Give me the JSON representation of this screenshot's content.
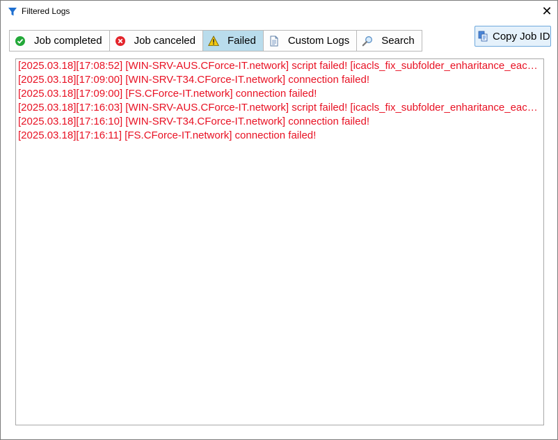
{
  "window": {
    "title": "Filtered Logs",
    "close_glyph": "✕"
  },
  "tabs": [
    {
      "label": "Job completed",
      "icon": "check-circle-icon",
      "color": "#22a838"
    },
    {
      "label": "Job canceled",
      "icon": "cancel-circle-icon",
      "color": "#e3242b"
    },
    {
      "label": "Failed",
      "icon": "warning-icon",
      "color": "#f2c811",
      "active": true
    },
    {
      "label": "Custom Logs",
      "icon": "document-icon",
      "color": "#5d7ea6"
    },
    {
      "label": "Search",
      "icon": "magnifier-icon",
      "color": "#5a8fc6"
    }
  ],
  "toolbar": {
    "copy_label": "Copy Job ID"
  },
  "logs": [
    "[2025.03.18][17:08:52] [WIN-SRV-AUS.CForce-IT.network] script failed! [icacls_fix_subfolder_enharitance_each_fil...",
    "[2025.03.18][17:09:00] [WIN-SRV-T34.CForce-IT.network] connection failed!",
    "[2025.03.18][17:09:00] [FS.CForce-IT.network] connection failed!",
    "[2025.03.18][17:16:03] [WIN-SRV-AUS.CForce-IT.network] script failed! [icacls_fix_subfolder_enharitance_each_fil...",
    "[2025.03.18][17:16:10] [WIN-SRV-T34.CForce-IT.network] connection failed!",
    "[2025.03.18][17:16:11] [FS.CForce-IT.network] connection failed!"
  ],
  "colors": {
    "error_text": "#e81123",
    "active_tab": "#b9dcec",
    "accent": "#1e6fd0"
  }
}
